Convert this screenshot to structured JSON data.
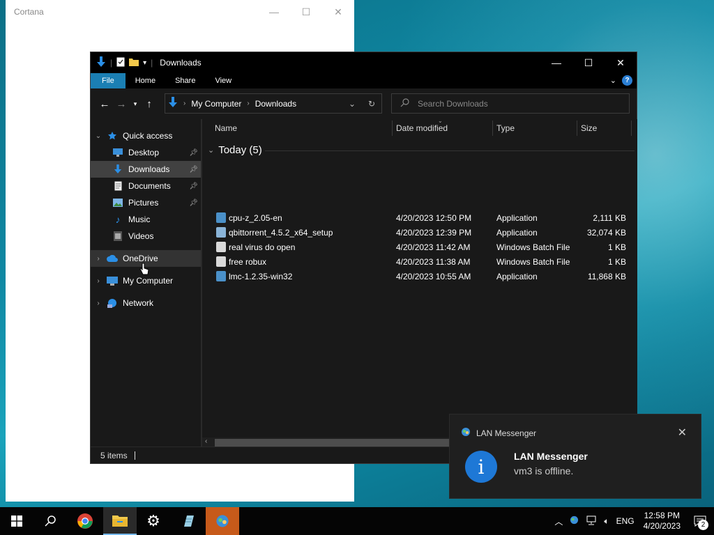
{
  "cortana": {
    "title": "Cortana",
    "controls": [
      "—",
      "☐",
      "✕"
    ]
  },
  "explorer": {
    "title": "Downloads",
    "controls": [
      "—",
      "☐",
      "✕"
    ],
    "ribbon_tabs": [
      "File",
      "Home",
      "Share",
      "View"
    ],
    "help_label": "?",
    "address": {
      "crumbs": [
        "My Computer",
        "Downloads"
      ]
    },
    "search": {
      "placeholder": "Search Downloads"
    },
    "nav": [
      {
        "label": "Quick access",
        "icon": "star-icon",
        "level": 0,
        "expanded": true
      },
      {
        "label": "Desktop",
        "icon": "desktop-icon",
        "level": 1,
        "pinned": true
      },
      {
        "label": "Downloads",
        "icon": "download-arrow-icon",
        "level": 1,
        "pinned": true,
        "selected": true
      },
      {
        "label": "Documents",
        "icon": "document-icon",
        "level": 1,
        "pinned": true
      },
      {
        "label": "Pictures",
        "icon": "picture-icon",
        "level": 1,
        "pinned": true
      },
      {
        "label": "Music",
        "icon": "music-note-icon",
        "level": 1
      },
      {
        "label": "Videos",
        "icon": "video-icon",
        "level": 1
      },
      {
        "label": "OneDrive",
        "icon": "cloud-icon",
        "level": 0
      },
      {
        "label": "My Computer",
        "icon": "computer-icon",
        "level": 0
      },
      {
        "label": "Network",
        "icon": "network-icon",
        "level": 0
      }
    ],
    "columns": {
      "name": "Name",
      "date": "Date modified",
      "type": "Type",
      "size": "Size"
    },
    "group_label": "Today (5)",
    "files": [
      {
        "name": "cpu-z_2.05-en",
        "date": "4/20/2023 12:50 PM",
        "type": "Application",
        "size": "2,111 KB",
        "icon": "app-icon"
      },
      {
        "name": "qbittorrent_4.5.2_x64_setup",
        "date": "4/20/2023 12:39 PM",
        "type": "Application",
        "size": "32,074 KB",
        "icon": "qbittorrent-icon"
      },
      {
        "name": "real virus do open",
        "date": "4/20/2023 11:42 AM",
        "type": "Windows Batch File",
        "size": "1 KB",
        "icon": "batch-file-icon"
      },
      {
        "name": "free robux",
        "date": "4/20/2023 11:38 AM",
        "type": "Windows Batch File",
        "size": "1 KB",
        "icon": "batch-file-icon"
      },
      {
        "name": "lmc-1.2.35-win32",
        "date": "4/20/2023 10:55 AM",
        "type": "Application",
        "size": "11,868 KB",
        "icon": "app-icon"
      }
    ],
    "status": "5 items"
  },
  "toast": {
    "app_name": "LAN Messenger",
    "title": "LAN Messenger",
    "message": "vm3 is offline.",
    "badge_glyph": "i"
  },
  "taskbar": {
    "language": "ENG",
    "time": "12:58 PM",
    "date": "4/20/2023",
    "notification_count": "2"
  }
}
